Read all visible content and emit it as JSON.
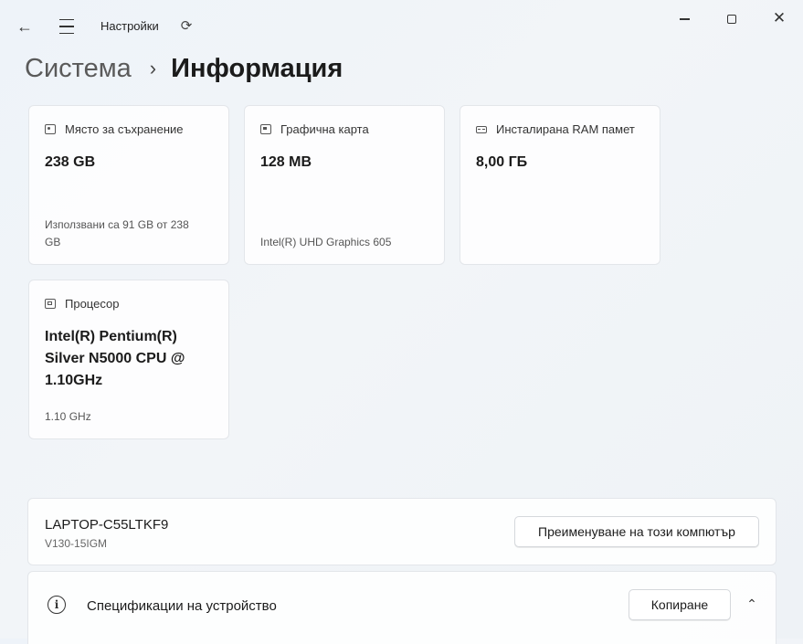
{
  "window": {
    "app_title": "Настройки",
    "back_icon": "back-arrow-icon",
    "menu_icon": "hamburger-menu-icon",
    "copilot_icon": "copilot-icon"
  },
  "breadcrumb": {
    "parent": "Система",
    "separator": "›",
    "current": "Информация"
  },
  "cards": {
    "storage": {
      "label": "Място за съхранение",
      "value": "238 GB",
      "sub_line1": "Използвани са 91 GB от 238",
      "sub_line2": "GB"
    },
    "gpu": {
      "label": "Графична карта",
      "value": "128 MB",
      "sub": "Intel(R) UHD Graphics 605"
    },
    "ram": {
      "label": "Инсталирана RAM памет",
      "value": "8,00 ГБ"
    },
    "cpu": {
      "label": "Процесор",
      "value_line1": "Intel(R) Pentium(R)",
      "value_line2": "Silver N5000 CPU @",
      "value_line3": "1.10GHz",
      "sub": "1.10 GHz"
    }
  },
  "device": {
    "name": "LAPTOP-C55LTKF9",
    "model": "V130-15IGM",
    "rename_button": "Преименуване на този компютър"
  },
  "specs": {
    "label": "Спецификации на устройство",
    "info_glyph": "i",
    "copy_button": "Копиране",
    "chevron": "⌃"
  }
}
